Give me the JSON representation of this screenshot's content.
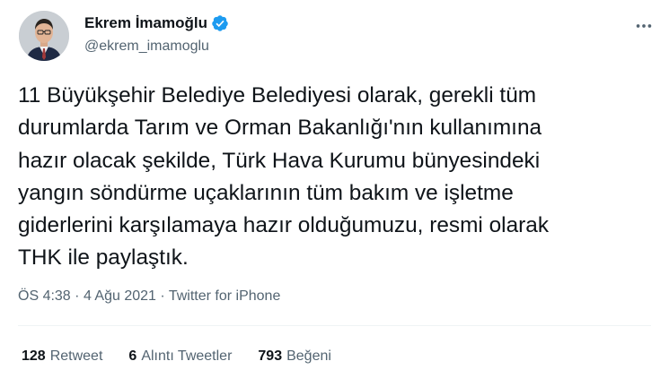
{
  "author": {
    "name": "Ekrem İmamoğlu",
    "handle": "@ekrem_imamoglu",
    "verified": true
  },
  "tweet": {
    "text": "11 Büyükşehir Belediye Belediyesi olarak, gerekli tüm\ndurumlarda Tarım ve Orman Bakanlığı'nın kullanımına\nhazır olacak şekilde, Türk Hava Kurumu bünyesindeki\nyangın söndürme uçaklarının tüm bakım ve işletme\ngiderlerini karşılamaya hazır olduğumuzu, resmi olarak\nTHK ile paylaştık."
  },
  "meta": {
    "time": "ÖS 4:38",
    "separator": "·",
    "date": "4 Ağu 2021",
    "source": "Twitter for iPhone"
  },
  "stats": {
    "retweets": {
      "count": "128",
      "label": "Retweet"
    },
    "quotes": {
      "count": "6",
      "label": "Alıntı Tweetler"
    },
    "likes": {
      "count": "793",
      "label": "Beğeni"
    }
  },
  "icons": {
    "verified": "verified-badge-icon",
    "more": "more-dots-icon"
  },
  "colors": {
    "text": "#0f1419",
    "secondary": "#536471",
    "verified": "#1d9bf0",
    "divider": "#eff3f4"
  }
}
